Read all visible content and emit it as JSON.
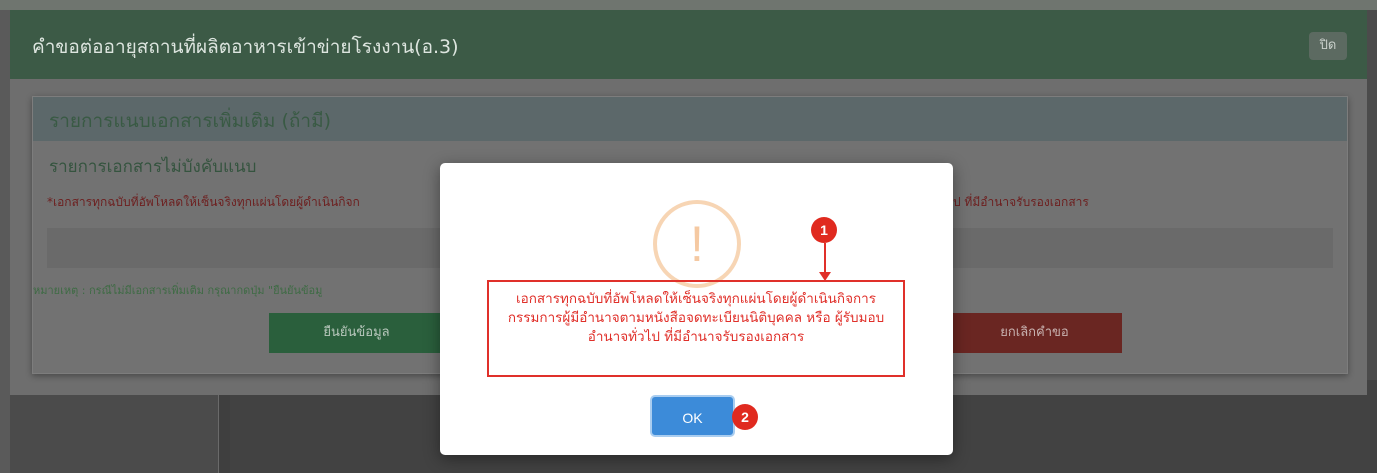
{
  "outer_modal": {
    "title": "คำขอต่ออายุสถานที่ผลิตอาหารเข้าข่ายโรงงาน(อ.3)",
    "close_label": "ปิด"
  },
  "panel": {
    "title": "รายการแนบเอกสารเพิ่มเติม (ถ้ามี)",
    "subtitle": "รายการเอกสารไม่บังคับแนบ",
    "note_star": "*",
    "note_left": "เอกสารทุกฉบับที่อัพโหลดให้เซ็นจริงทุกแผ่นโดยผู้ดำเนินกิจก",
    "note_right": "ป ที่มีอำนาจรับรองเอกสาร",
    "remark": "หมายเหตุ : กรณีไม่มีเอกสารเพิ่มเติม กรุณากดปุ่ม \"ยืนยันข้อมู",
    "confirm_label": "ยืนยันข้อมูล",
    "cancel_label": "ยกเลิกคำขอ"
  },
  "alert": {
    "icon": "exclamation-icon",
    "icon_glyph": "!",
    "message": "เอกสารทุกฉบับที่อัพโหลดให้เซ็นจริงทุกแผ่นโดยผู้ดำเนินกิจการ กรรมการผู้มีอำนาจตามหนังสือจดทะเบียนนิติบุคคล หรือ ผู้รับมอบอำนาจทั่วไป ที่มีอำนาจรับรองเอกสาร",
    "ok_label": "OK"
  },
  "annotations": {
    "badge_1": "1",
    "badge_2": "2",
    "highlight_color": "#e0302a"
  },
  "colors": {
    "header_green": "#3c5a46",
    "ok_blue": "#3c8bd9",
    "confirm_green": "#2a5f3c",
    "cancel_red": "#6a2622"
  }
}
